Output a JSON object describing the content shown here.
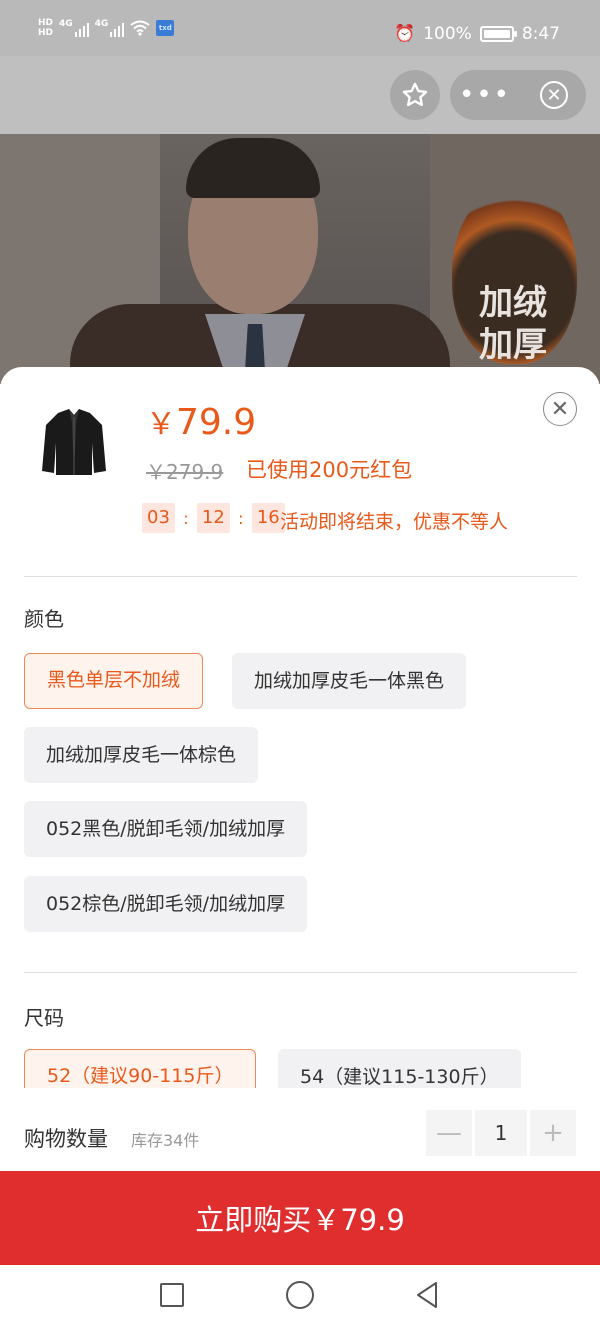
{
  "status_bar": {
    "hd1": "HD",
    "hd2": "HD",
    "sig1": "4G",
    "sig2": "4G",
    "battery_pct": "100%",
    "time": "8:47",
    "extra_badge": "txd"
  },
  "nav": {
    "more_label": "•••"
  },
  "hero": {
    "badge_line1": "加绒",
    "badge_line2": "加厚"
  },
  "product": {
    "price_symbol": "￥",
    "price": "79.9",
    "original_price": "￥279.9",
    "coupon_text": "已使用200元红包",
    "countdown": {
      "h": "03",
      "m": "12",
      "s": "16",
      "sep": ":"
    },
    "countdown_text": "活动即将结束，优惠不等人"
  },
  "color_section": {
    "title": "颜色",
    "options": [
      {
        "label": "黑色单层不加绒",
        "selected": true
      },
      {
        "label": "加绒加厚皮毛一体黑色",
        "selected": false
      },
      {
        "label": "加绒加厚皮毛一体棕色",
        "selected": false
      },
      {
        "label": "052黑色/脱卸毛领/加绒加厚",
        "selected": false
      },
      {
        "label": "052棕色/脱卸毛领/加绒加厚",
        "selected": false
      }
    ]
  },
  "size_section": {
    "title": "尺码",
    "options": [
      {
        "label": "52（建议90-115斤）",
        "selected": true
      },
      {
        "label": "54（建议115-130斤）",
        "selected": false
      }
    ]
  },
  "quantity": {
    "label": "购物数量",
    "stock": "库存34件",
    "value": "1",
    "minus": "—",
    "plus": "+"
  },
  "buy_button": {
    "label": "立即购买￥79.9"
  },
  "colors": {
    "accent": "#e8591a",
    "buy_bg": "#e02e2f"
  }
}
